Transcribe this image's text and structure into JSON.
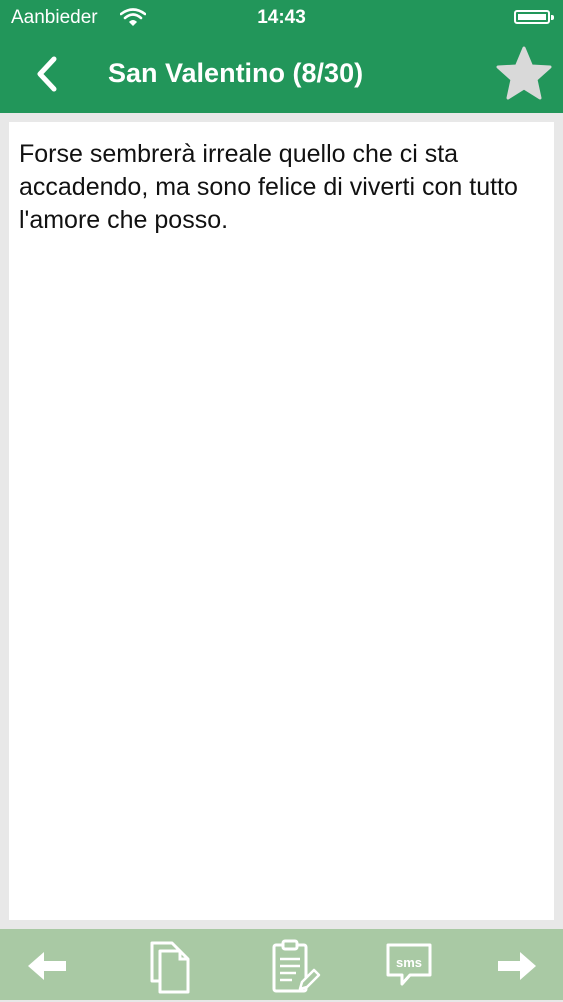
{
  "status_bar": {
    "carrier": "Aanbieder",
    "time": "14:43"
  },
  "nav": {
    "title": "San Valentino (8/30)"
  },
  "message": {
    "text": "Forse sembrerà irreale quello che ci sta accadendo, ma sono felice di viverti con tutto l'amore che posso."
  },
  "toolbar": {
    "sms_label": "sms"
  },
  "colors": {
    "nav_background": "#22965a",
    "toolbar_background": "#a9c9a4",
    "star_color": "#d9d9d9"
  }
}
